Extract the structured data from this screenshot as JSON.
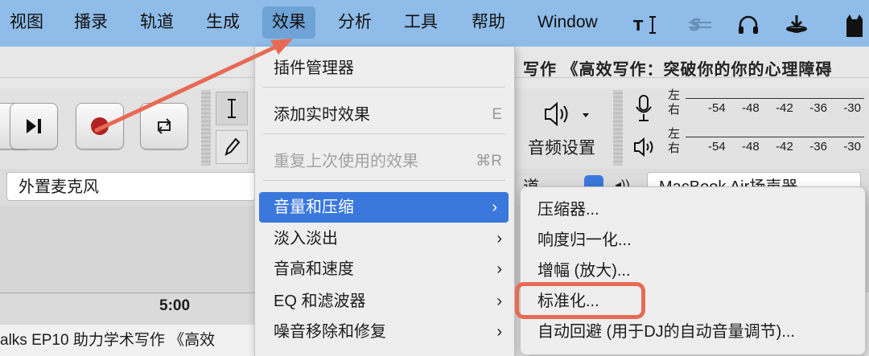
{
  "menubar": {
    "items": [
      "视图",
      "播录",
      "轨道",
      "生成",
      "效果",
      "分析",
      "工具",
      "帮助",
      "Window"
    ],
    "active_index": 4,
    "colors": {
      "bar": "#8fbce8",
      "active": "#6fa3d6"
    }
  },
  "window": {
    "title_fragment": "写作 《高效写作：突破你的你的心理障碍"
  },
  "toolbar": {
    "audio_settings_label": "音频设置",
    "meter_rows": [
      {
        "channel_top": "左",
        "channel_bottom": "右",
        "ticks": [
          "-54",
          "-48",
          "-42",
          "-36",
          "-30"
        ]
      },
      {
        "channel_top": "左",
        "channel_bottom": "右",
        "ticks": [
          "-54",
          "-48",
          "-42",
          "-36",
          "-30"
        ]
      }
    ]
  },
  "device": {
    "input_device": "外置麦克风",
    "channels_fragment": "道",
    "output_device": "MacBook Air扬声器"
  },
  "timeline": {
    "ruler_label": "5:00",
    "track_name": "alks EP10 助力学术写作 《高效"
  },
  "effects_menu": {
    "items": [
      {
        "label": "插件管理器",
        "shortcut": "",
        "submenu": false,
        "disabled": false
      },
      {
        "label": "添加实时效果",
        "shortcut": "E",
        "submenu": false,
        "disabled": false
      },
      {
        "label": "重复上次使用的效果",
        "shortcut": "⌘R",
        "submenu": false,
        "disabled": true
      },
      {
        "label": "音量和压缩",
        "shortcut": "",
        "submenu": true,
        "disabled": false,
        "highlighted": true
      },
      {
        "label": "淡入淡出",
        "shortcut": "",
        "submenu": true,
        "disabled": false
      },
      {
        "label": "音高和速度",
        "shortcut": "",
        "submenu": true,
        "disabled": false
      },
      {
        "label": "EQ 和滤波器",
        "shortcut": "",
        "submenu": true,
        "disabled": false
      },
      {
        "label": "噪音移除和修复",
        "shortcut": "",
        "submenu": true,
        "disabled": false
      }
    ],
    "highlight_color": "#3b78dc"
  },
  "volume_submenu": {
    "items": [
      "压缩器...",
      "响度归一化...",
      "增幅 (放大)...",
      "标准化...",
      "自动回避 (用于DJ的自动音量调节)..."
    ],
    "annotated_index": 3,
    "annotation_color": "#e86a55"
  }
}
